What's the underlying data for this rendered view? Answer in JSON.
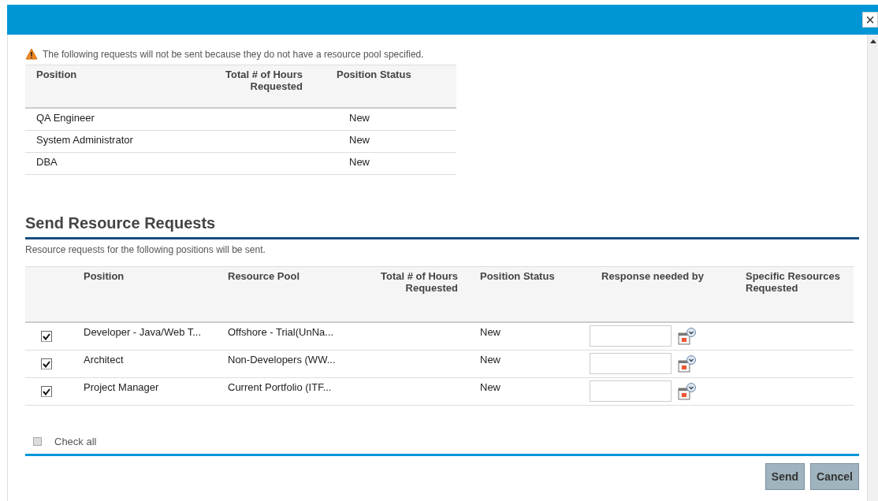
{
  "dialog": {
    "close_label": "×"
  },
  "warning": {
    "message": "The following requests will not be sent because they do not have a resource pool specified."
  },
  "unsent_table": {
    "columns": [
      "Position",
      "Total # of Hours Requested",
      "Position Status"
    ],
    "rows": [
      {
        "position": "QA Engineer",
        "status": "New"
      },
      {
        "position": "System Administrator",
        "status": "New"
      },
      {
        "position": "DBA",
        "status": "New"
      }
    ]
  },
  "send_section": {
    "title": "Send Resource Requests",
    "subtitle": "Resource requests for the following positions will be sent.",
    "columns": [
      "Position",
      "Resource Pool",
      "Total # of Hours Requested",
      "Position Status",
      "Response needed by",
      "Specific Resources Requested"
    ],
    "rows": [
      {
        "checked": true,
        "position": "Developer - Java/Web T...",
        "pool": "Offshore - Trial(UnNa...",
        "status": "New"
      },
      {
        "checked": true,
        "position": "Architect",
        "pool": "Non-Developers (WW...",
        "status": "New"
      },
      {
        "checked": true,
        "position": "Project Manager",
        "pool": "Current Portfolio (ITF...",
        "status": "New"
      }
    ],
    "check_all": {
      "label": "Check all",
      "checked": false
    }
  },
  "buttons": [
    "Send",
    "Cancel"
  ]
}
